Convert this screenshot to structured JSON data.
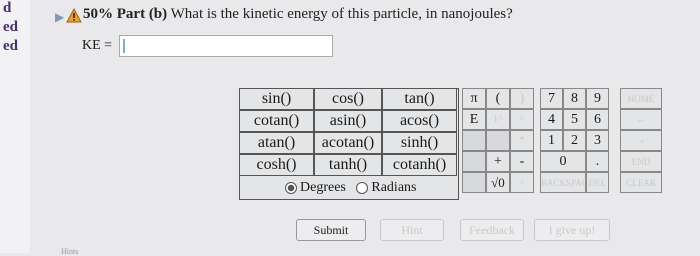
{
  "sidebar": {
    "items": [
      "d",
      "ed",
      "ed"
    ]
  },
  "question": {
    "percent": "50%",
    "part": "Part (b)",
    "prompt": "What is the kinetic energy of this particle, in nanojoules?"
  },
  "answer": {
    "label": "KE =",
    "value": ""
  },
  "functions": [
    [
      "sin()",
      "cos()",
      "tan()"
    ],
    [
      "cotan()",
      "asin()",
      "acos()"
    ],
    [
      "atan()",
      "acotan()",
      "sinh()"
    ],
    [
      "cosh()",
      "tanh()",
      "cotanh()"
    ]
  ],
  "angle_mode": {
    "degrees": "Degrees",
    "radians": "Radians",
    "selected": "degrees"
  },
  "symbols": {
    "pi": "π",
    "open_paren": "(",
    "close_paren": ")",
    "e": "E",
    "pow": "1^",
    "pow_n": "^",
    "mult": "*",
    "plus": "+",
    "minus": "-",
    "sqrt": "√0",
    "div": "/"
  },
  "keypad": {
    "row1": [
      "7",
      "8",
      "9"
    ],
    "row2": [
      "4",
      "5",
      "6"
    ],
    "row3": [
      "1",
      "2",
      "3"
    ],
    "zero": "0",
    "dot": "."
  },
  "side_keys": {
    "home": "HOME",
    "left": "←",
    "right": "→",
    "end": "END",
    "clear": "CLEAR",
    "backspace": "BACKSPACE",
    "del": "DEL"
  },
  "buttons": {
    "submit": "Submit",
    "hint": "Hint",
    "feedback": "Feedback",
    "give_up": "I give up!"
  },
  "hints_label": "Hints"
}
